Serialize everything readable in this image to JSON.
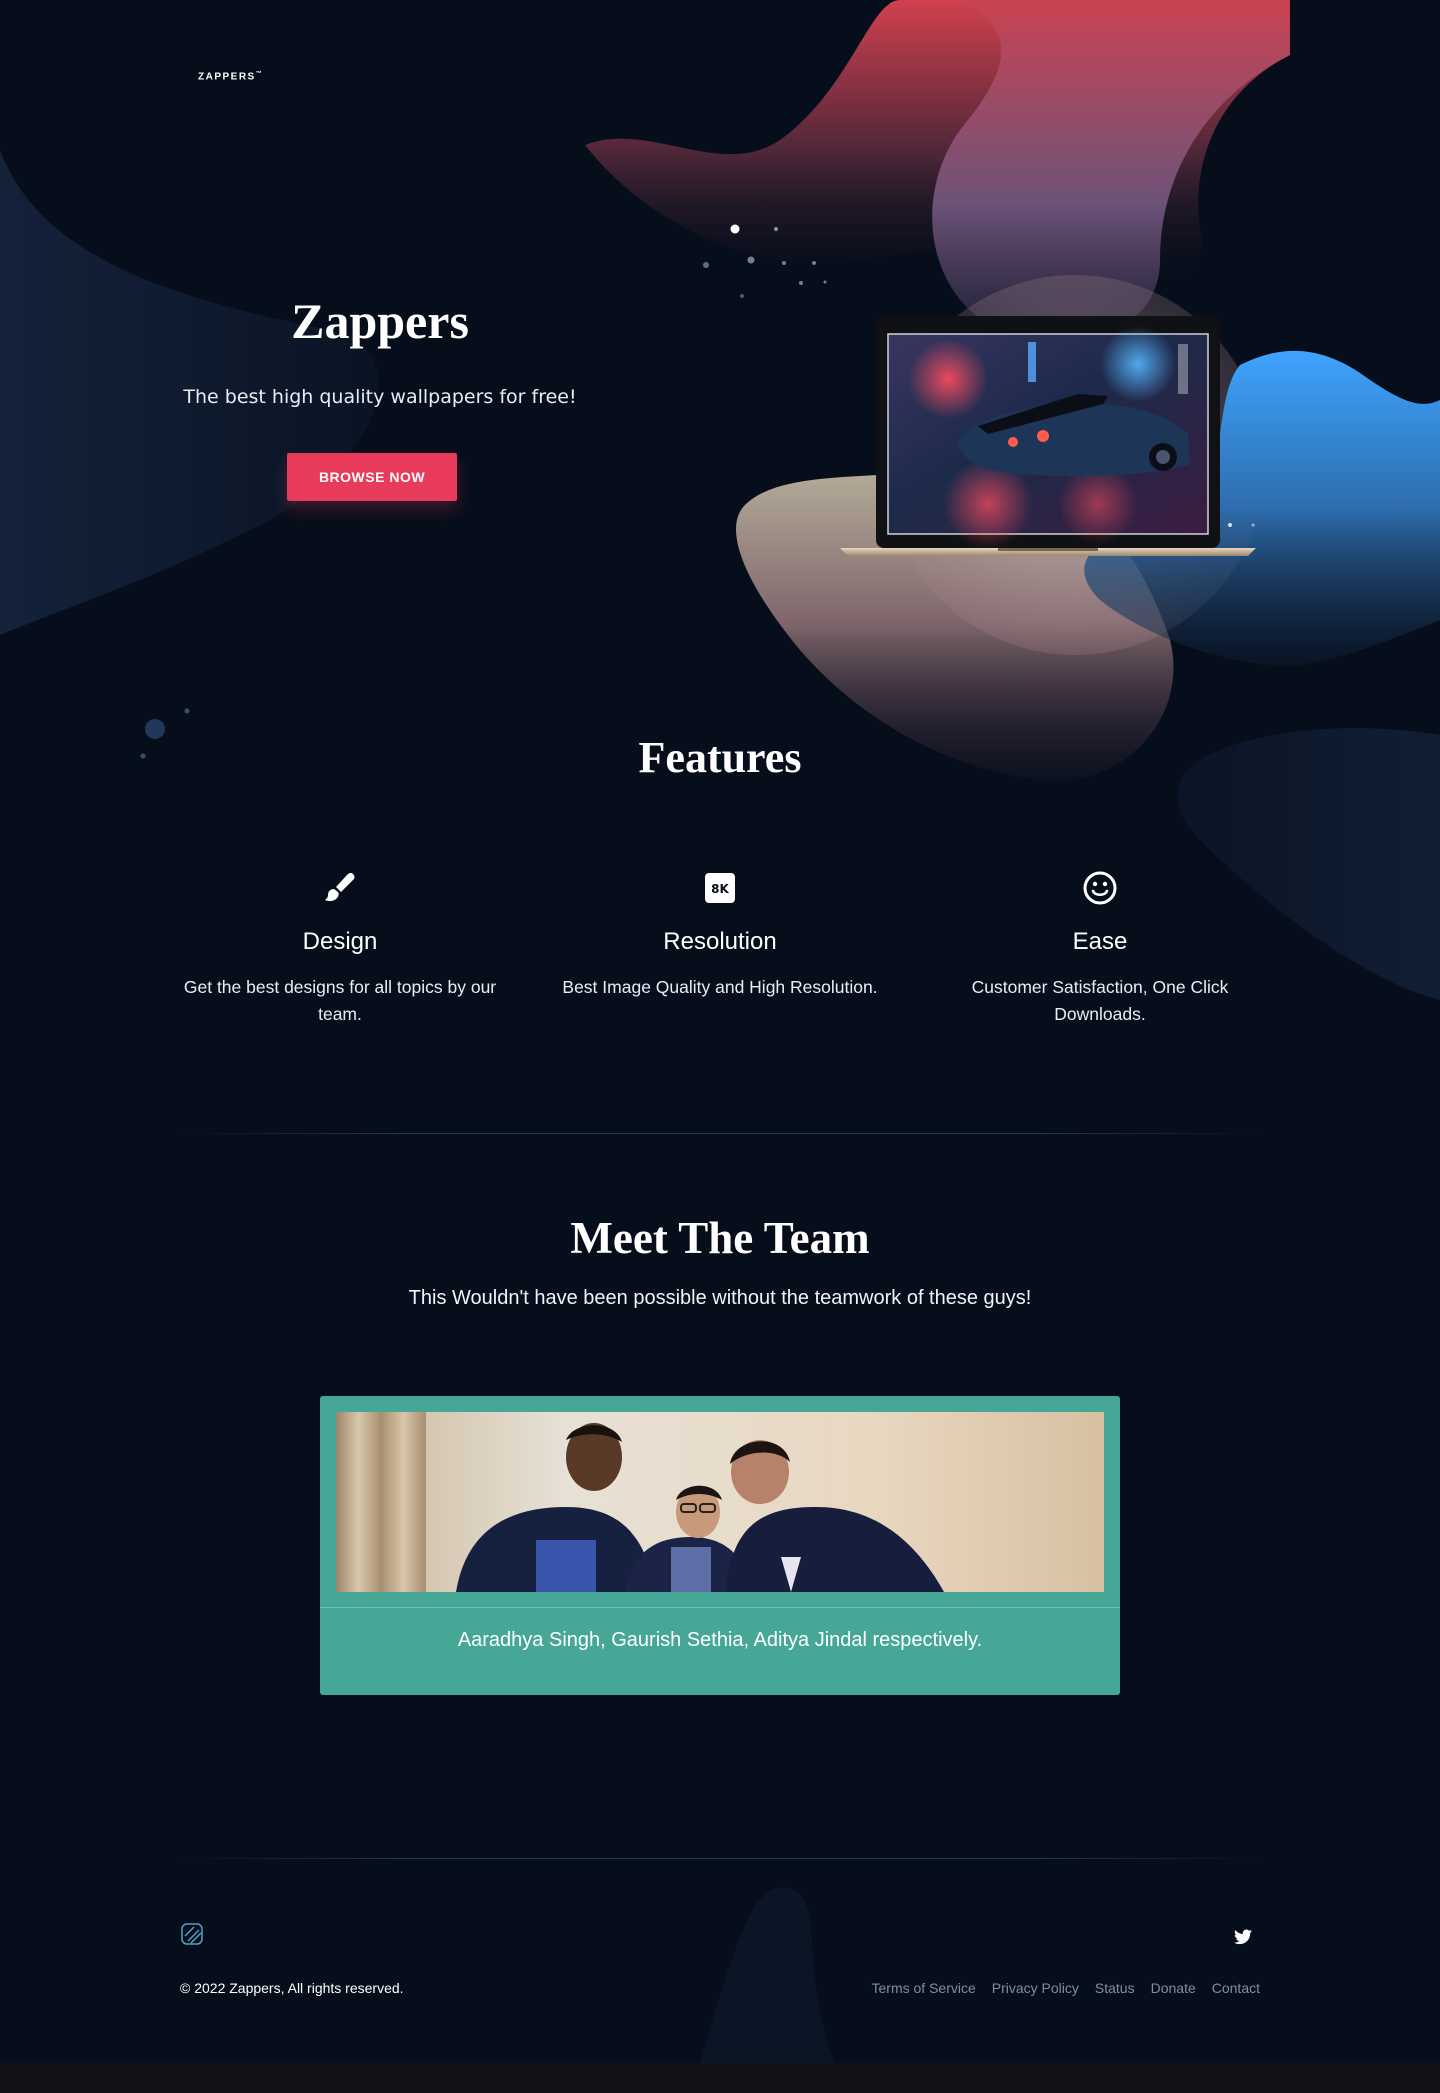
{
  "header": {
    "logo_text": "ZAPPERS",
    "logo_tm": "™"
  },
  "hero": {
    "title": "Zappers",
    "subtitle": "The best high quality wallpapers for free!",
    "cta_label": "BROWSE NOW"
  },
  "features": {
    "title": "Features",
    "items": [
      {
        "icon": "paintbrush-icon",
        "title": "Design",
        "text": "Get the best designs for all topics by our team."
      },
      {
        "icon": "8k-icon",
        "icon_text": "8K",
        "title": "Resolution",
        "text": "Best Image Quality and High Resolution."
      },
      {
        "icon": "smiley-icon",
        "title": "Ease",
        "text": "Customer Satisfaction, One Click Downloads."
      }
    ]
  },
  "team": {
    "title": "Meet The Team",
    "subtitle": "This Wouldn't have been possible without the teamwork of these guys!",
    "caption": "Aaradhya Singh, Gaurish Sethia, Aditya Jindal respectively."
  },
  "footer": {
    "copyright": "© 2022 Zappers, All rights reserved.",
    "links": [
      "Terms of Service",
      "Privacy Policy",
      "Status",
      "Donate",
      "Contact"
    ]
  },
  "colors": {
    "background": "#070e1b",
    "accent": "#e83a5b",
    "team_card": "#46a797",
    "footer_link": "#7f8ea3"
  }
}
